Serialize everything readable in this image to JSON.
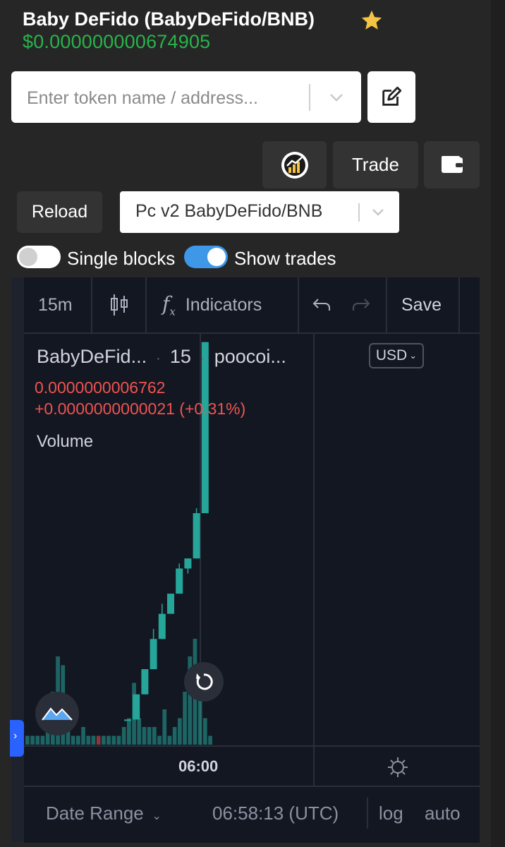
{
  "header": {
    "title": "Baby DeFido (BabyDeFido/BNB)",
    "price": "$0.000000000674905",
    "favorite_icon": "star-icon",
    "colors": {
      "price": "#27b44a",
      "star": "#f5c343"
    }
  },
  "search": {
    "placeholder": "Enter token name / address...",
    "value": ""
  },
  "buttons": {
    "trade": "Trade",
    "reload": "Reload",
    "chart_icon": "chart-coin-icon",
    "wallet_icon": "wallet-icon",
    "edit_icon": "edit-icon"
  },
  "pair_select": {
    "selected": "Pc v2 BabyDeFido/BNB"
  },
  "toggles": {
    "single_blocks": {
      "label": "Single blocks",
      "on": false
    },
    "show_trades": {
      "label": "Show trades",
      "on": true
    }
  },
  "chart_toolbar": {
    "interval": "15m",
    "indicators": "Indicators",
    "save": "Save"
  },
  "chart_legend": {
    "symbol": "BabyDeFid...",
    "interval": "15",
    "source": "poocoi...",
    "close": "0.0000000006762",
    "change": "+0.0000000000021 (+0.31%)",
    "volume_label": "Volume",
    "currency": "USD"
  },
  "chart_bottom": {
    "time_axis_label": "06:00",
    "date_range": "Date Range",
    "clock": "06:58:13 (UTC)",
    "log": "log",
    "auto": "auto"
  },
  "chart_data": {
    "type": "candlestick",
    "candles": [
      {
        "o": 0.5,
        "c": 0.5,
        "h": 0.5,
        "l": 0.5,
        "color": "#26a69a"
      },
      {
        "o": 0.5,
        "c": 1.0,
        "h": 1.0,
        "l": 0.5,
        "color": "#26a69a"
      },
      {
        "o": 1.0,
        "c": 1.5,
        "h": 1.5,
        "l": 1.0,
        "color": "#26a69a"
      },
      {
        "o": 1.5,
        "c": 2.1,
        "h": 2.3,
        "l": 1.5,
        "color": "#26a69a"
      },
      {
        "o": 2.1,
        "c": 2.6,
        "h": 2.8,
        "l": 2.1,
        "color": "#26a69a"
      },
      {
        "o": 2.6,
        "c": 3.0,
        "h": 3.0,
        "l": 2.6,
        "color": "#26a69a"
      },
      {
        "o": 3.0,
        "c": 3.5,
        "h": 3.6,
        "l": 3.0,
        "color": "#26a69a"
      },
      {
        "o": 3.5,
        "c": 3.7,
        "h": 3.7,
        "l": 3.4,
        "color": "#26a69a"
      },
      {
        "o": 3.7,
        "c": 4.6,
        "h": 4.7,
        "l": 3.7,
        "color": "#26a69a"
      },
      {
        "o": 4.6,
        "c": 8.0,
        "h": 8.0,
        "l": 4.6,
        "color": "#26a69a"
      }
    ],
    "volume": [
      1,
      1,
      1,
      1,
      2,
      6,
      10,
      9,
      3,
      1,
      1,
      2,
      1,
      1,
      1,
      1,
      1,
      1,
      1,
      2,
      3,
      7,
      3,
      2,
      2,
      2,
      1,
      4,
      1,
      2,
      3,
      6,
      10,
      12,
      9,
      3,
      1
    ],
    "volume_colors": [
      "#26a69a",
      "#ef5350"
    ],
    "x_tick": "06:00",
    "currency": "USD",
    "grid": true
  }
}
